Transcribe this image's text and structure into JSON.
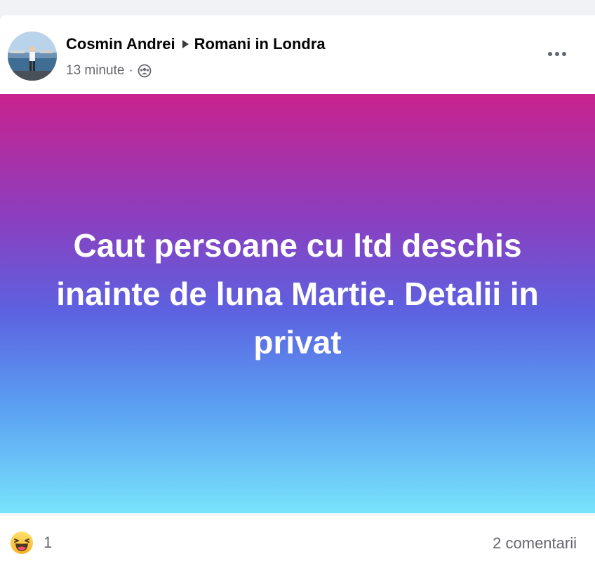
{
  "post": {
    "author": "Cosmin Andrei",
    "group": "Romani in Londra",
    "time": "13 minute",
    "separator": "·",
    "audience_icon": "group-audience-icon",
    "more_icon": "more-options-icon",
    "text": "Caut persoane cu ltd deschis inainte de luna Martie. Detalii in privat",
    "background_gradient": [
      "#c9228e",
      "#8a3fc0",
      "#5c62e0",
      "#5a9ef2",
      "#78e3fb"
    ]
  },
  "footer": {
    "reaction_icon": "haha-reaction-icon",
    "reaction_count": "1",
    "comments": "2 comentarii"
  }
}
